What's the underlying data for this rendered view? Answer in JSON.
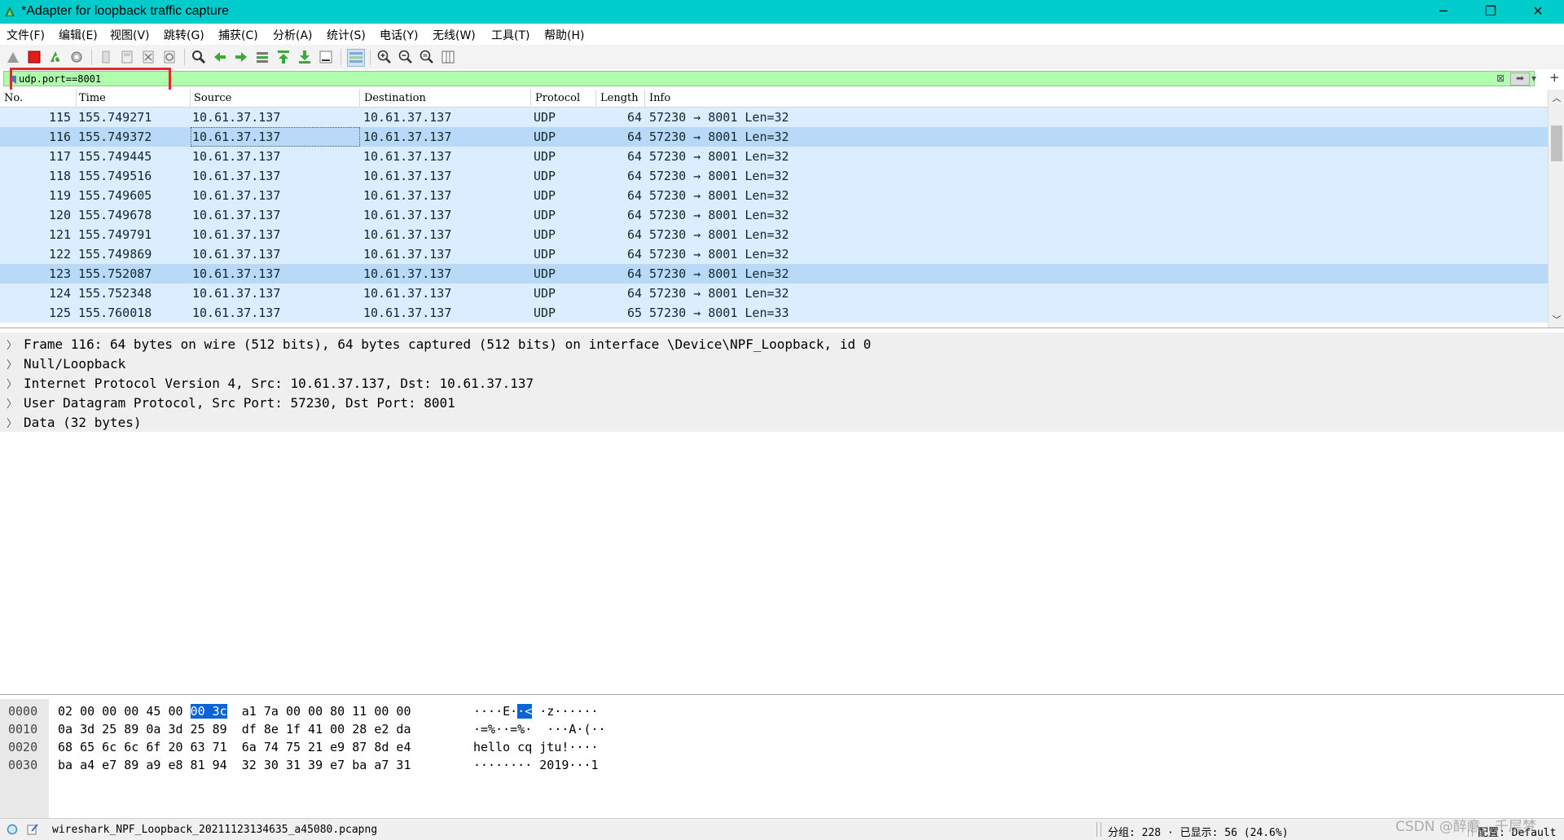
{
  "window": {
    "title": "*Adapter for loopback traffic capture",
    "controls": [
      "─",
      "❐",
      "✕"
    ]
  },
  "menu": [
    "文件(F)",
    "编辑(E)",
    "视图(V)",
    "跳转(G)",
    "捕获(C)",
    "分析(A)",
    "统计(S)",
    "电话(Y)",
    "无线(W)",
    "工具(T)",
    "帮助(H)"
  ],
  "toolbar": {
    "icons": [
      "shark-fin-icon",
      "stop-capture-icon",
      "restart-capture-icon",
      "capture-options-icon",
      "open-file-icon",
      "save-file-icon",
      "close-file-icon",
      "reload-file-icon",
      "find-packet-icon",
      "go-back-icon",
      "go-forward-icon",
      "go-to-packet-icon",
      "go-first-icon",
      "go-last-icon",
      "auto-scroll-icon",
      "colorize-icon",
      "zoom-in-icon",
      "zoom-out-icon",
      "zoom-normal-icon",
      "resize-columns-icon"
    ]
  },
  "filter": {
    "value": "udp.port==8001",
    "bg_color": "#afffaf"
  },
  "packet_list": {
    "columns": [
      "No.",
      "Time",
      "Source",
      "Destination",
      "Protocol",
      "Length",
      "Info"
    ],
    "rows": [
      {
        "no": "115",
        "time": "155.749271",
        "src": "10.61.37.137",
        "dst": "10.61.37.137",
        "proto": "UDP",
        "len": "64",
        "info": "57230 → 8001 Len=32"
      },
      {
        "no": "116",
        "time": "155.749372",
        "src": "10.61.37.137",
        "dst": "10.61.37.137",
        "proto": "UDP",
        "len": "64",
        "info": "57230 → 8001 Len=32"
      },
      {
        "no": "117",
        "time": "155.749445",
        "src": "10.61.37.137",
        "dst": "10.61.37.137",
        "proto": "UDP",
        "len": "64",
        "info": "57230 → 8001 Len=32"
      },
      {
        "no": "118",
        "time": "155.749516",
        "src": "10.61.37.137",
        "dst": "10.61.37.137",
        "proto": "UDP",
        "len": "64",
        "info": "57230 → 8001 Len=32"
      },
      {
        "no": "119",
        "time": "155.749605",
        "src": "10.61.37.137",
        "dst": "10.61.37.137",
        "proto": "UDP",
        "len": "64",
        "info": "57230 → 8001 Len=32"
      },
      {
        "no": "120",
        "time": "155.749678",
        "src": "10.61.37.137",
        "dst": "10.61.37.137",
        "proto": "UDP",
        "len": "64",
        "info": "57230 → 8001 Len=32"
      },
      {
        "no": "121",
        "time": "155.749791",
        "src": "10.61.37.137",
        "dst": "10.61.37.137",
        "proto": "UDP",
        "len": "64",
        "info": "57230 → 8001 Len=32"
      },
      {
        "no": "122",
        "time": "155.749869",
        "src": "10.61.37.137",
        "dst": "10.61.37.137",
        "proto": "UDP",
        "len": "64",
        "info": "57230 → 8001 Len=32"
      },
      {
        "no": "123",
        "time": "155.752087",
        "src": "10.61.37.137",
        "dst": "10.61.37.137",
        "proto": "UDP",
        "len": "64",
        "info": "57230 → 8001 Len=32"
      },
      {
        "no": "124",
        "time": "155.752348",
        "src": "10.61.37.137",
        "dst": "10.61.37.137",
        "proto": "UDP",
        "len": "64",
        "info": "57230 → 8001 Len=32"
      },
      {
        "no": "125",
        "time": "155.760018",
        "src": "10.61.37.137",
        "dst": "10.61.37.137",
        "proto": "UDP",
        "len": "65",
        "info": "57230 → 8001 Len=33"
      }
    ],
    "row_color": "#daeeff",
    "selected_row_color": "#b8daf8"
  },
  "details": [
    "Frame 116: 64 bytes on wire (512 bits), 64 bytes captured (512 bits) on interface \\Device\\NPF_Loopback, id 0",
    "Null/Loopback",
    "Internet Protocol Version 4, Src: 10.61.37.137, Dst: 10.61.37.137",
    "User Datagram Protocol, Src Port: 57230, Dst Port: 8001",
    "Data (32 bytes)"
  ],
  "bytes": [
    {
      "offset": "0000",
      "hex_a": "02 00 00 00 45 00 ",
      "hex_hl": "00 3c",
      "hex_b": "  a1 7a 00 00 80 11 00 00",
      "asc_a": "····E·",
      "asc_hl": "·<",
      "asc_b": " ·z······"
    },
    {
      "offset": "0010",
      "hex_a": "0a 3d 25 89 0a 3d 25 89  df 8e 1f 41 00 28 e2 da",
      "hex_hl": "",
      "hex_b": "",
      "asc_a": "·=%··=%·  ···A·(··",
      "asc_hl": "",
      "asc_b": ""
    },
    {
      "offset": "0020",
      "hex_a": "68 65 6c 6c 6f 20 63 71  6a 74 75 21 e9 87 8d e4",
      "hex_hl": "",
      "hex_b": "",
      "asc_a": "hello cq jtu!····",
      "asc_hl": "",
      "asc_b": ""
    },
    {
      "offset": "0030",
      "hex_a": "ba a4 e7 89 a9 e8 81 94  32 30 31 39 e7 ba a7 31",
      "hex_hl": "",
      "hex_b": "",
      "asc_a": "········ 2019···1",
      "asc_hl": "",
      "asc_b": ""
    }
  ],
  "status": {
    "file": "wireshark_NPF_Loopback_20211123134635_a45080.pcapng",
    "stats": "分组: 228 · 已显示: 56 (24.6%)",
    "profile": "配置: Default"
  },
  "watermark": "CSDN @醉意、千层梦"
}
